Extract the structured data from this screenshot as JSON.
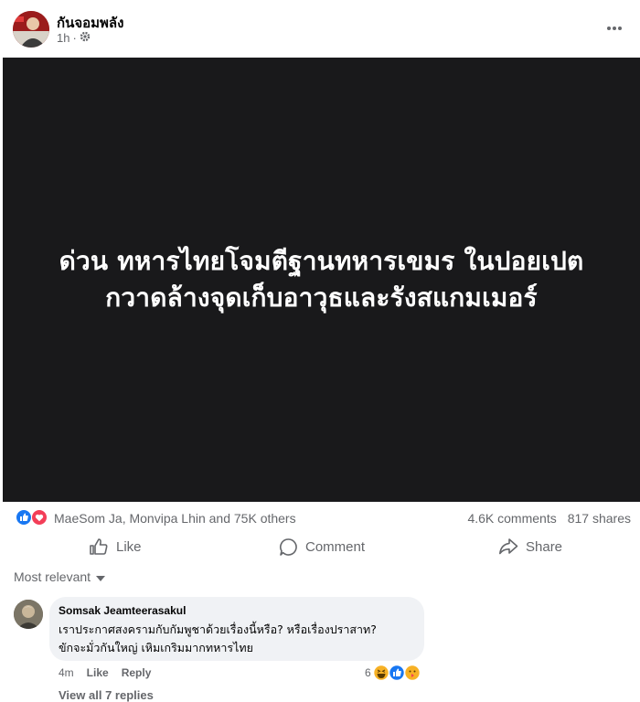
{
  "post": {
    "page_name": "กันจอมพลัง",
    "time": "1h",
    "separator": "·",
    "headline": [
      "ด่วน ทหารไทยโจมตีฐานทหารเขมร ในปอยเปต",
      "กวาดล้างจุดเก็บอาวุธและรังสแกมเมอร์"
    ]
  },
  "stats": {
    "reactors": "MaeSom Ja, Monvipa Lhin and 75K others",
    "comments": "4.6K comments",
    "shares": "817 shares"
  },
  "actions": {
    "like": "Like",
    "comment": "Comment",
    "share": "Share"
  },
  "comments_sort": "Most relevant",
  "comment": {
    "author": "Somsak Jeamteerasakul",
    "lines": [
      "เราประกาศสงครามกับกัมพูชาด้วยเรื่องนี้หรือ? หรือเรื่องปราสาท?",
      "ขักจะมั่วกันใหญ่ เหิมเกริมมากทหารไทย"
    ],
    "time": "4m",
    "like": "Like",
    "reply": "Reply",
    "reaction_count": "6"
  },
  "view_more": "View all 7 replies",
  "colors": {
    "like_blue": "#1877f2",
    "love_red": "#f33e58",
    "meta_gray": "#65676b",
    "bubble": "#f0f2f5",
    "image_bg": "#19191b"
  },
  "icons": [
    "gear-icon",
    "more-dots-icon",
    "like-reaction-icon",
    "love-reaction-icon",
    "thumbs-up-icon",
    "comment-icon",
    "share-icon",
    "chevron-down-icon",
    "haha-reaction-icon",
    "care-reaction-icon"
  ]
}
